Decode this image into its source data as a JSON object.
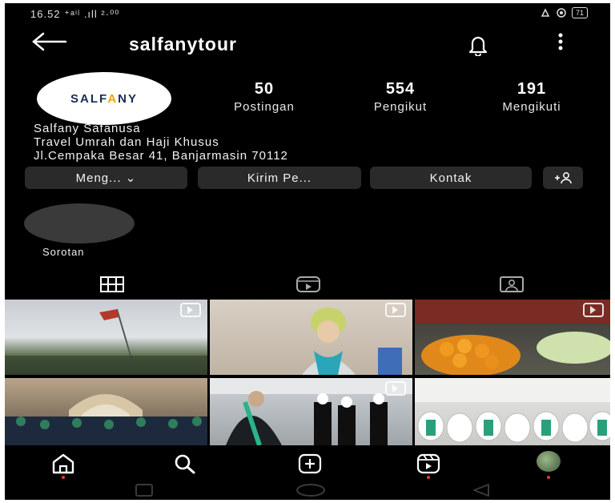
{
  "status_bar": {
    "time_and_signal": "16.52 ⁺ᵃⁱˡ .ıll ²·⁰⁰",
    "battery": "71"
  },
  "header": {
    "username": "salfanytour"
  },
  "profile": {
    "logo_text_1": "SALF",
    "logo_text_a": "A",
    "logo_text_2": "NY",
    "stats": [
      {
        "number": "50",
        "label": "Postingan"
      },
      {
        "number": "554",
        "label": "Pengikut"
      },
      {
        "number": "191",
        "label": "Mengikuti"
      }
    ],
    "bio_lines": [
      "Salfany Safanusa",
      "Travel Umrah dan Haji Khusus",
      "Jl.Cempaka Besar 41, Banjarmasin 70112"
    ]
  },
  "actions": {
    "following": "Meng... ⌄",
    "message": "Kirim Pe...",
    "contact": "Kontak",
    "add_person": "+⚇"
  },
  "highlights": {
    "label": "Sorotan"
  },
  "colors": {
    "background": "#000000",
    "button": "#2a2a2a",
    "notification_dot": "#e53935"
  },
  "icons": [
    "back-arrow-icon",
    "bell-icon",
    "more-vert-icon",
    "grid-icon",
    "reels-icon",
    "tagged-icon",
    "home-icon",
    "search-icon",
    "create-icon",
    "reels-nav-icon"
  ]
}
